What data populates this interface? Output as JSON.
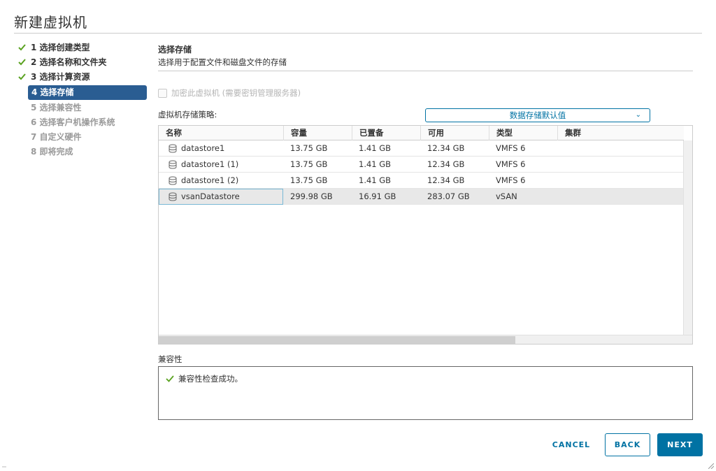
{
  "window": {
    "title": "新建虚拟机"
  },
  "steps": [
    {
      "label": "1 选择创建类型",
      "state": "done"
    },
    {
      "label": "2 选择名称和文件夹",
      "state": "done"
    },
    {
      "label": "3 选择计算资源",
      "state": "done"
    },
    {
      "label": "4 选择存储",
      "state": "active"
    },
    {
      "label": "5 选择兼容性",
      "state": "pending"
    },
    {
      "label": "6 选择客户机操作系统",
      "state": "pending"
    },
    {
      "label": "7 自定义硬件",
      "state": "pending"
    },
    {
      "label": "8 即将完成",
      "state": "pending"
    }
  ],
  "section": {
    "title": "选择存储",
    "subtitle": "选择用于配置文件和磁盘文件的存储"
  },
  "encrypt": {
    "label": "加密此虚拟机 (需要密钥管理服务器)",
    "checked": false,
    "disabled": true
  },
  "policy": {
    "label": "虚拟机存储策略:",
    "value": "数据存储默认值",
    "chevron_icon": "chevron-down-icon"
  },
  "table": {
    "columns": [
      "名称",
      "容量",
      "已置备",
      "可用",
      "类型",
      "集群"
    ],
    "rows": [
      {
        "name": "datastore1",
        "capacity": "13.75 GB",
        "provisioned": "1.41 GB",
        "free": "12.34 GB",
        "type": "VMFS 6",
        "cluster": ""
      },
      {
        "name": "datastore1 (1)",
        "capacity": "13.75 GB",
        "provisioned": "1.41 GB",
        "free": "12.34 GB",
        "type": "VMFS 6",
        "cluster": ""
      },
      {
        "name": "datastore1 (2)",
        "capacity": "13.75 GB",
        "provisioned": "1.41 GB",
        "free": "12.34 GB",
        "type": "VMFS 6",
        "cluster": ""
      },
      {
        "name": "vsanDatastore",
        "capacity": "299.98 GB",
        "provisioned": "16.91 GB",
        "free": "283.07 GB",
        "type": "vSAN",
        "cluster": "",
        "selected": true
      }
    ],
    "row_icon": "database-icon"
  },
  "compatibility": {
    "label": "兼容性",
    "message": "兼容性检查成功。",
    "icon": "check-icon"
  },
  "buttons": {
    "cancel": "CANCEL",
    "back": "BACK",
    "next": "NEXT"
  },
  "colors": {
    "accent": "#0072a3",
    "active_step": "#2a5d92",
    "success": "#5aa220"
  }
}
